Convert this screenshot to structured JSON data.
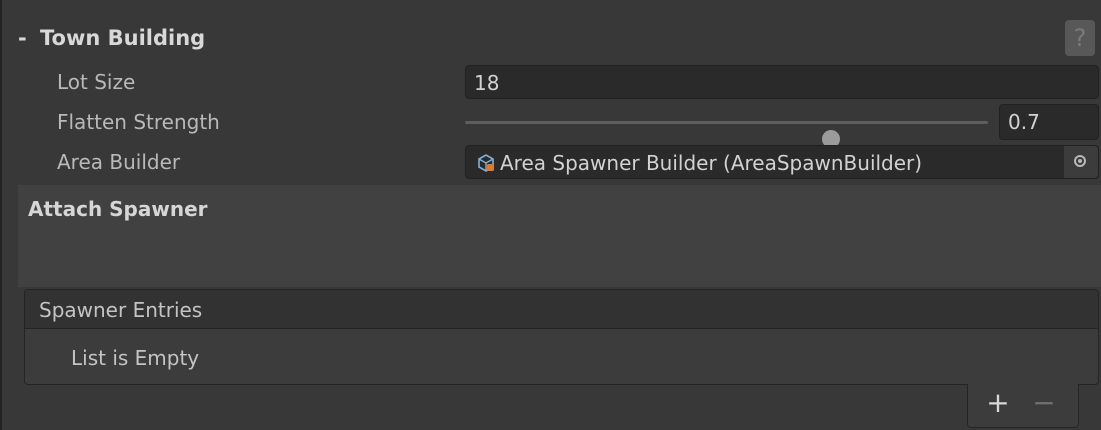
{
  "header": {
    "collapse_symbol": "-",
    "title": "Town Building",
    "help_symbol": "?"
  },
  "fields": {
    "lot_size": {
      "label": "Lot Size",
      "value": "18"
    },
    "flatten_strength": {
      "label": "Flatten Strength",
      "value": "0.7",
      "slider_fraction": 0.7
    },
    "area_builder": {
      "label": "Area Builder",
      "value": "Area Spawner Builder (AreaSpawnBuilder)",
      "icon": "script-object-icon"
    }
  },
  "attach": {
    "title": "Attach Spawner"
  },
  "list": {
    "header": "Spawner Entries",
    "empty_text": "List is Empty",
    "add_symbol": "+",
    "remove_symbol": "−"
  },
  "colors": {
    "background": "#383838",
    "field_bg": "#2a2a2a",
    "panel_bg": "#414141",
    "text": "#c4c4c4"
  }
}
